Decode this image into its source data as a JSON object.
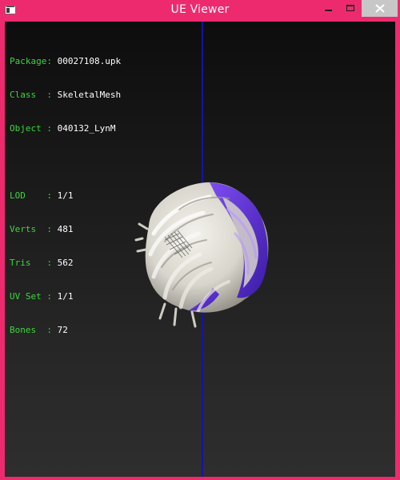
{
  "window": {
    "title": "UE Viewer",
    "accent_color": "#ee2a6e",
    "buttons": {
      "minimize_icon": "minimize-icon",
      "maximize_icon": "maximize-icon",
      "close_icon": "close-icon"
    }
  },
  "info": {
    "package": {
      "label": "Package:",
      "value": "00027108.upk"
    },
    "class": {
      "label": "Class  :",
      "value": "SkeletalMesh"
    },
    "object": {
      "label": "Object :",
      "value": "040132_LynM"
    },
    "lod": {
      "label": "LOD    :",
      "value": "1/1"
    },
    "verts": {
      "label": "Verts  :",
      "value": "481"
    },
    "tris": {
      "label": "Tris   :",
      "value": "562"
    },
    "uvset": {
      "label": "UV Set :",
      "value": "1/1"
    },
    "bones": {
      "label": "Bones  :",
      "value": "72"
    }
  },
  "colors": {
    "label": "#3fd43f",
    "value": "#ffffff",
    "axis": "#1414a8",
    "mesh_base": "#e6e4de",
    "mesh_accent": "#5a2ad6"
  }
}
